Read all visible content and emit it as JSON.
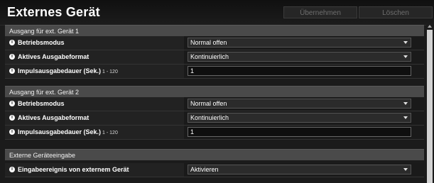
{
  "header": {
    "title": "Externes Gerät",
    "apply_label": "Übernehmen",
    "delete_label": "Löschen"
  },
  "sections": [
    {
      "title": "Ausgang für ext. Gerät 1",
      "rows": [
        {
          "label": "Betriebsmodus",
          "value": "Normal offen",
          "type": "select"
        },
        {
          "label": "Aktives Ausgabeformat",
          "value": "Kontinuierlich",
          "type": "select"
        },
        {
          "label": "Impulsausgabedauer (Sek.)",
          "range": "1 - 120",
          "value": "1",
          "type": "input"
        }
      ]
    },
    {
      "title": "Ausgang für ext. Gerät 2",
      "rows": [
        {
          "label": "Betriebsmodus",
          "value": "Normal offen",
          "type": "select"
        },
        {
          "label": "Aktives Ausgabeformat",
          "value": "Kontinuierlich",
          "type": "select"
        },
        {
          "label": "Impulsausgabedauer (Sek.)",
          "range": "1 - 120",
          "value": "1",
          "type": "input"
        }
      ]
    },
    {
      "title": "Externe Geräteeingabe",
      "rows": [
        {
          "label": "Eingabeereignis von externem Gerät",
          "value": "Aktivieren",
          "type": "select"
        }
      ]
    }
  ],
  "info_icon": "info-icon"
}
